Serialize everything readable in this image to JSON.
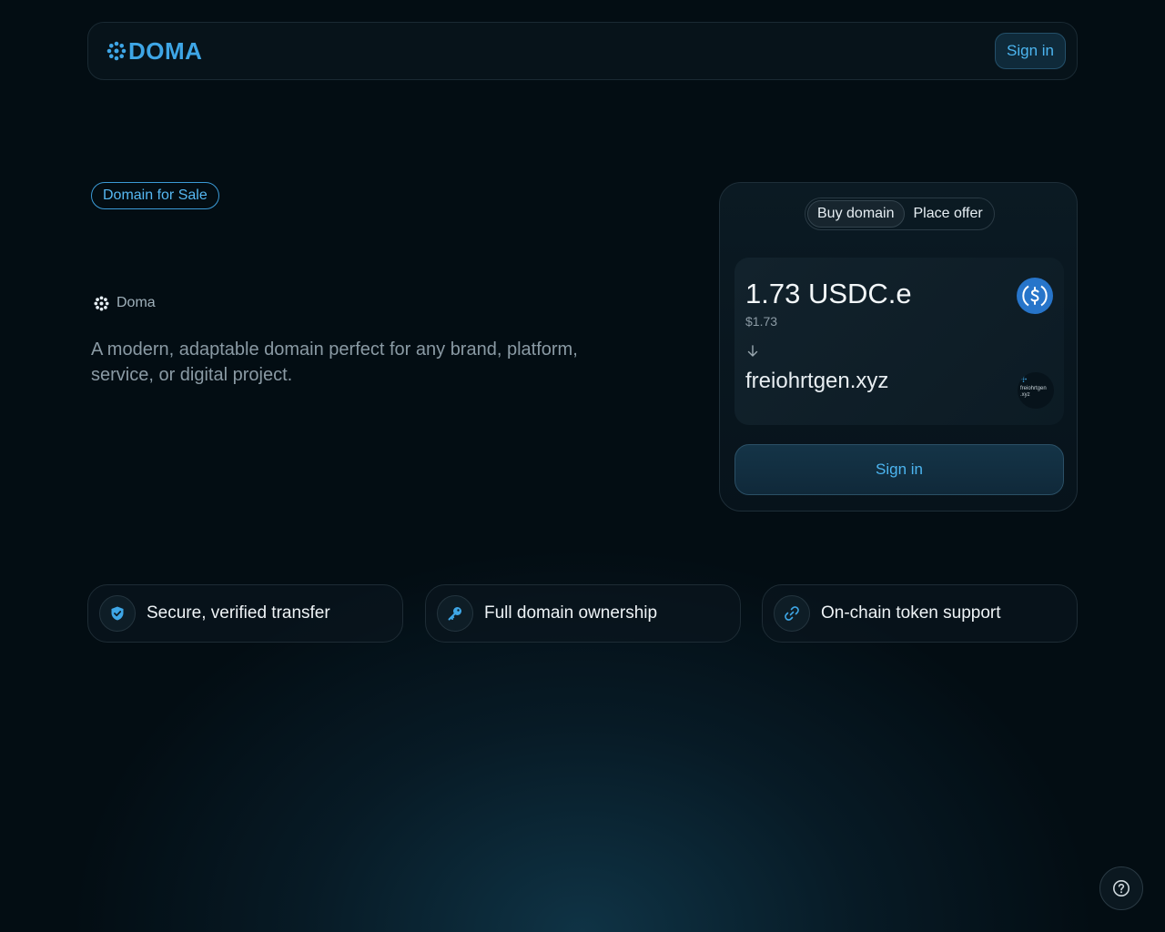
{
  "header": {
    "logo_text": "DOMA",
    "sign_in_label": "Sign in"
  },
  "hero": {
    "badge": "Domain for Sale",
    "brand_name": "Doma",
    "description": "A modern, adaptable domain perfect for any brand, platform, service, or digital project."
  },
  "panel": {
    "tabs": [
      {
        "label": "Buy domain",
        "active": true
      },
      {
        "label": "Place offer",
        "active": false
      }
    ],
    "amount": "1.73 USDC.e",
    "fiat_value": "$1.73",
    "token_icon": "usdc-icon",
    "domain_name": "freiohrtgen.xyz",
    "domain_thumb_text": "freiohrtgen .xyz",
    "sign_in_label": "Sign in"
  },
  "features": [
    {
      "label": "Secure, verified transfer",
      "icon": "shield-check-icon"
    },
    {
      "label": "Full domain ownership",
      "icon": "key-icon"
    },
    {
      "label": "On-chain token support",
      "icon": "link-icon"
    }
  ],
  "help_icon": "help-icon",
  "colors": {
    "accent": "#3ea6e6",
    "background": "#030d13",
    "usdc_blue": "#2775ca"
  }
}
